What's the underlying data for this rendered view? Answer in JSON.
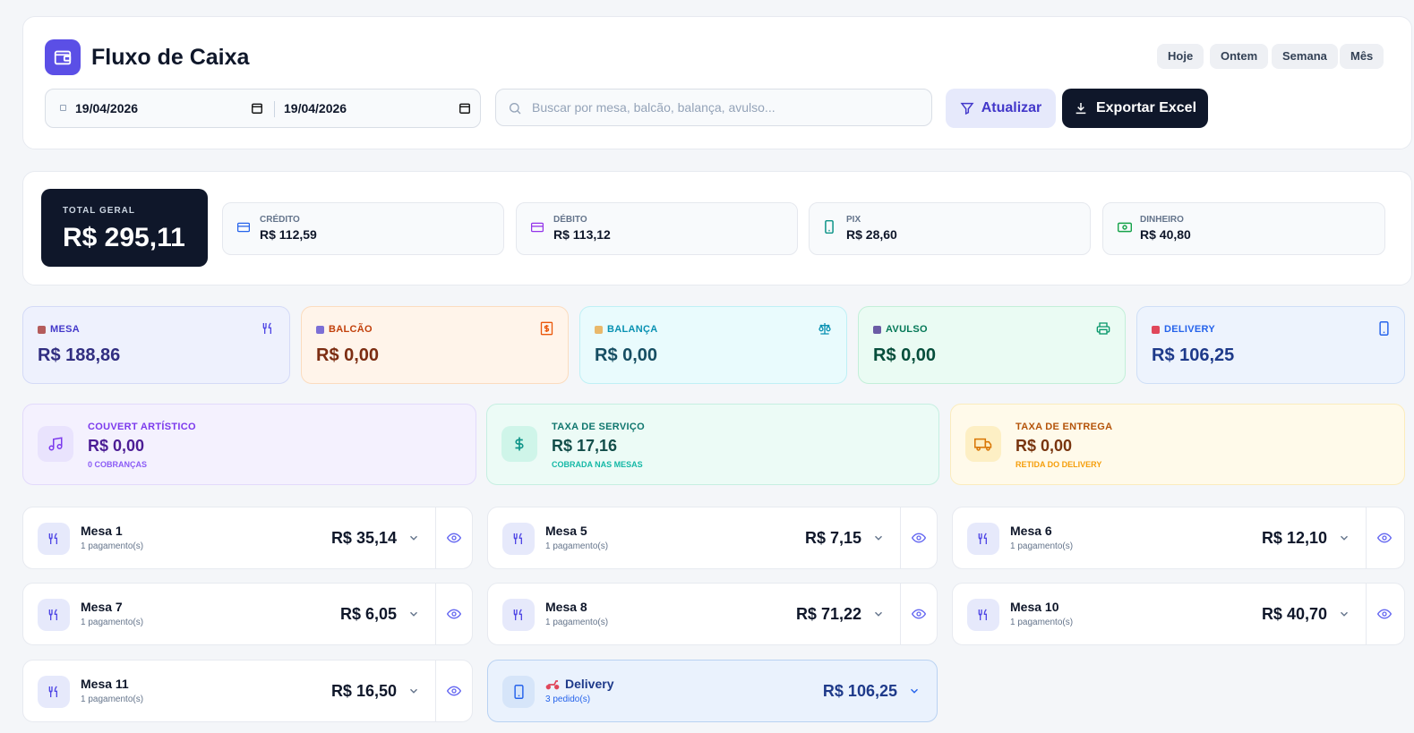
{
  "header": {
    "title": "Fluxo de Caixa",
    "quick_filters": [
      "Hoje",
      "Ontem",
      "Semana",
      "Mês"
    ],
    "date_from": "19/04/2026",
    "date_to": "19/04/2026",
    "search_placeholder": "Buscar por mesa, balcão, balança, avulso...",
    "refresh_label": "Atualizar",
    "export_label": "Exportar Excel"
  },
  "totals": {
    "total_label": "TOTAL GERAL",
    "total_value": "R$ 295,11",
    "payments": [
      {
        "label": "CRÉDITO",
        "value": "R$ 112,59",
        "icon": "credit-card-icon",
        "color": "#2563eb"
      },
      {
        "label": "DÉBITO",
        "value": "R$ 113,12",
        "icon": "debit-card-icon",
        "color": "#9333ea"
      },
      {
        "label": "PIX",
        "value": "R$ 28,60",
        "icon": "phone-icon",
        "color": "#0d9488"
      },
      {
        "label": "DINHEIRO",
        "value": "R$ 40,80",
        "icon": "cash-icon",
        "color": "#16a34a"
      }
    ]
  },
  "categories": [
    {
      "label": "MESA",
      "value": "R$ 188,86",
      "icon": "utensils-icon"
    },
    {
      "label": "BALCÃO",
      "value": "R$ 0,00",
      "icon": "receipt-icon"
    },
    {
      "label": "BALANÇA",
      "value": "R$ 0,00",
      "icon": "scale-icon"
    },
    {
      "label": "AVULSO",
      "value": "R$ 0,00",
      "icon": "printer-icon"
    },
    {
      "label": "DELIVERY",
      "value": "R$ 106,25",
      "icon": "phone-icon"
    }
  ],
  "fees": [
    {
      "label": "COUVERT ARTÍSTICO",
      "value": "R$ 0,00",
      "sub": "0 COBRANÇAS",
      "icon": "music-icon"
    },
    {
      "label": "TAXA DE SERVIÇO",
      "value": "R$ 17,16",
      "sub": "COBRADA NAS MESAS",
      "icon": "dollar-icon"
    },
    {
      "label": "TAXA DE ENTREGA",
      "value": "R$ 0,00",
      "sub": "RETIDA DO DELIVERY",
      "icon": "truck-icon"
    }
  ],
  "rows": [
    {
      "name": "Mesa 1",
      "sub": "1 pagamento(s)",
      "amount": "R$ 35,14"
    },
    {
      "name": "Mesa 5",
      "sub": "1 pagamento(s)",
      "amount": "R$ 7,15"
    },
    {
      "name": "Mesa 6",
      "sub": "1 pagamento(s)",
      "amount": "R$ 12,10"
    },
    {
      "name": "Mesa 7",
      "sub": "1 pagamento(s)",
      "amount": "R$ 6,05"
    },
    {
      "name": "Mesa 8",
      "sub": "1 pagamento(s)",
      "amount": "R$ 71,22"
    },
    {
      "name": "Mesa 10",
      "sub": "1 pagamento(s)",
      "amount": "R$ 40,70"
    },
    {
      "name": "Mesa 11",
      "sub": "1 pagamento(s)",
      "amount": "R$ 16,50"
    },
    {
      "name": "Delivery",
      "sub": "3 pedido(s)",
      "amount": "R$ 106,25"
    }
  ]
}
